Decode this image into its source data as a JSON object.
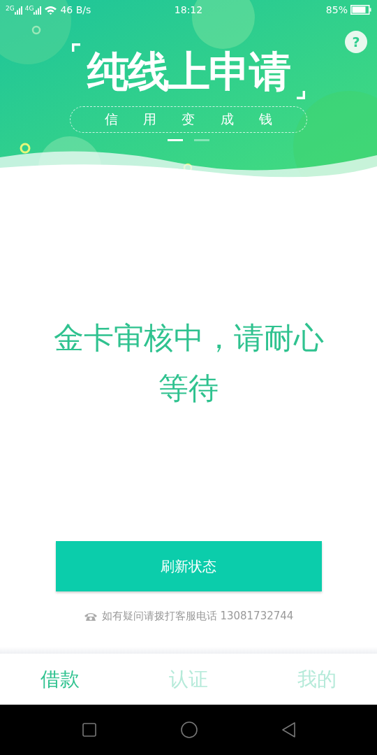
{
  "status_bar": {
    "network_labels": [
      "2G",
      "4G"
    ],
    "speed": "46 B/s",
    "time": "18:12",
    "battery": "85%"
  },
  "banner": {
    "title": "纯线上申请",
    "subtitle": "信用变成钱",
    "pages": [
      {
        "selected": true
      },
      {
        "selected": false
      }
    ],
    "help": "?"
  },
  "message": "金卡审核中，请耐心等待",
  "refresh_button": "刷新状态",
  "contact": "如有疑问请拨打客服电话 13081732744",
  "tabs": [
    {
      "label": "借款",
      "selected": true
    },
    {
      "label": "认证",
      "selected": false
    },
    {
      "label": "我的",
      "selected": false
    }
  ]
}
